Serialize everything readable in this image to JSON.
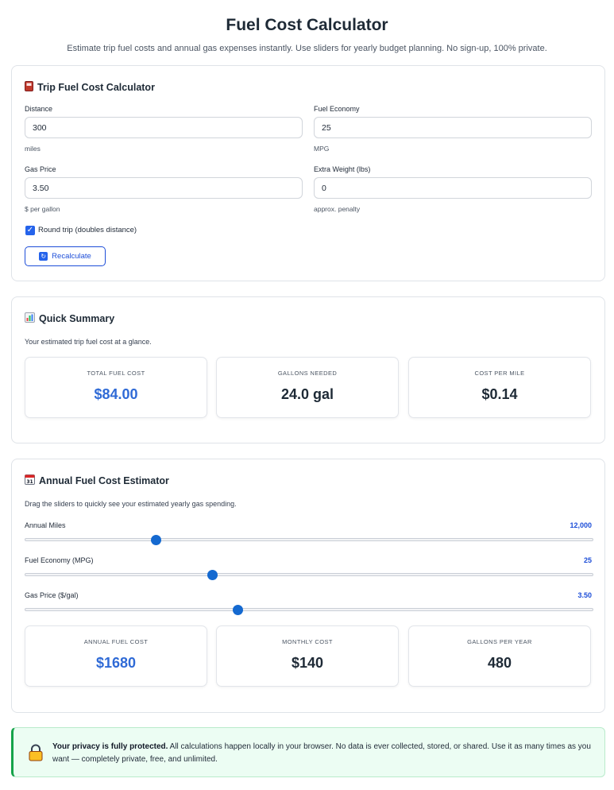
{
  "header": {
    "title": "Fuel Cost Calculator",
    "subtitle": "Estimate trip fuel costs and annual gas expenses instantly. Use sliders for yearly budget planning. No sign-up, 100% private."
  },
  "trip": {
    "title": "Trip Fuel Cost Calculator",
    "icon": "fuel-pump-icon",
    "fields": {
      "distance": {
        "label": "Distance",
        "value": "300",
        "hint": "miles"
      },
      "economy": {
        "label": "Fuel Economy",
        "value": "25",
        "hint": "MPG"
      },
      "price": {
        "label": "Gas Price",
        "value": "3.50",
        "hint": "$ per gallon"
      },
      "weight": {
        "label": "Extra Weight (lbs)",
        "value": "0",
        "hint": "approx. penalty"
      }
    },
    "round_trip": {
      "label": "Round trip (doubles distance)",
      "checked": true
    },
    "recalculate_label": "Recalculate"
  },
  "summary": {
    "title": "Quick Summary",
    "icon": "bar-chart-icon",
    "description": "Your estimated trip fuel cost at a glance.",
    "stats": [
      {
        "label": "Total Fuel Cost",
        "value": "$84.00"
      },
      {
        "label": "Gallons Needed",
        "value": "24.0 gal"
      },
      {
        "label": "Cost Per Mile",
        "value": "$0.14"
      }
    ]
  },
  "annual": {
    "title": "Annual Fuel Cost Estimator",
    "icon": "calendar-icon",
    "description": "Drag the sliders to quickly see your estimated yearly gas spending.",
    "sliders": [
      {
        "label": "Annual Miles",
        "value_text": "12,000",
        "fraction": 0.23
      },
      {
        "label": "Fuel Economy (MPG)",
        "value_text": "25",
        "fraction": 0.33
      },
      {
        "label": "Gas Price ($/gal)",
        "value_text": "3.50",
        "fraction": 0.375
      }
    ],
    "stats": [
      {
        "label": "Annual Fuel Cost",
        "value": "$1680"
      },
      {
        "label": "Monthly Cost",
        "value": "$140"
      },
      {
        "label": "Gallons Per Year",
        "value": "480"
      }
    ]
  },
  "privacy": {
    "heading": "Your privacy is fully protected.",
    "body": " All calculations happen locally in your browser. No data is ever collected, stored, or shared. Use it as many times as you want — completely private, free, and unlimited."
  },
  "colors": {
    "accent": "#2f6ad6",
    "slider_thumb": "#1469d0",
    "privacy_bg": "#ecfdf3",
    "privacy_border": "#16a34a"
  }
}
